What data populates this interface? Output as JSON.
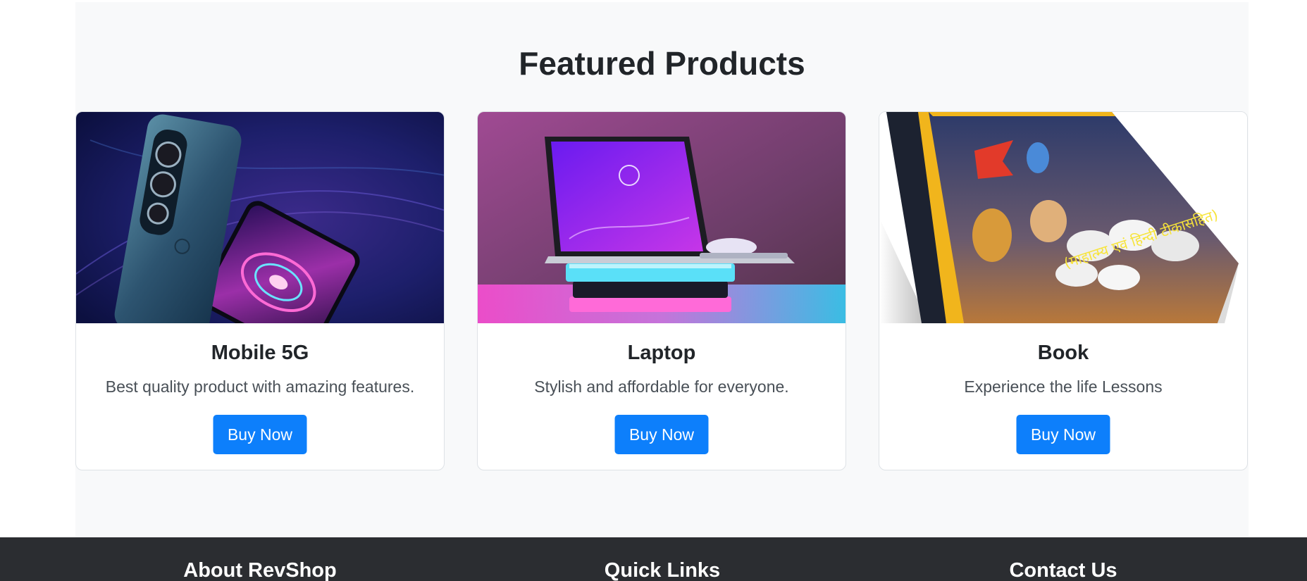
{
  "featured": {
    "title": "Featured Products",
    "products": [
      {
        "name": "Mobile 5G",
        "description": "Best quality product with amazing features.",
        "button_label": "Buy Now",
        "image": "smartphone-image"
      },
      {
        "name": "Laptop",
        "description": "Stylish and affordable for everyone.",
        "button_label": "Buy Now",
        "image": "laptop-image"
      },
      {
        "name": "Book",
        "description": "Experience the life Lessons",
        "button_label": "Buy Now",
        "image": "book-image",
        "image_text": "(माहात्म्य एवं हिन्दी टीकासहित)"
      }
    ]
  },
  "footer": {
    "headings": [
      "About RevShop",
      "Quick Links",
      "Contact Us"
    ]
  },
  "colors": {
    "primary_button": "#0d7ffb",
    "section_background": "#f8f9fa",
    "footer_background": "#2b2d31"
  }
}
